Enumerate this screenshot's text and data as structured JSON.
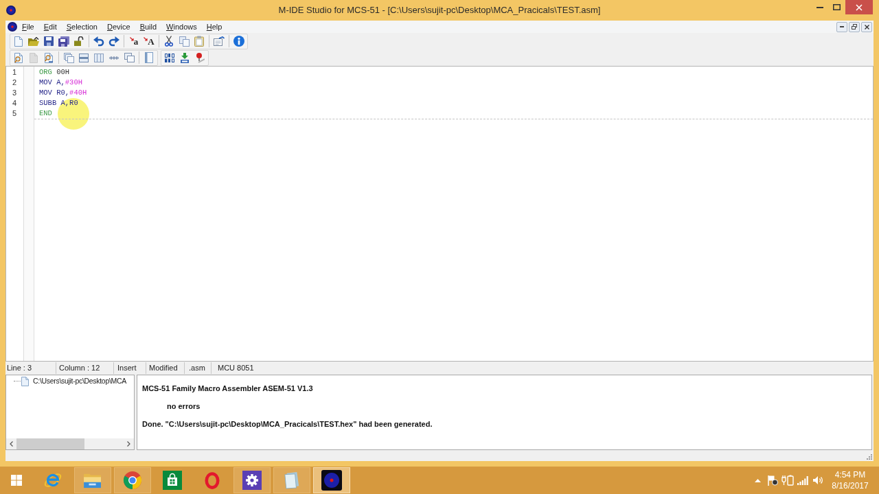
{
  "window": {
    "title": "M-IDE Studio for MCS-51 - [C:\\Users\\sujit-pc\\Desktop\\MCA_Pracicals\\TEST.asm]"
  },
  "menu": [
    "File",
    "Edit",
    "Selection",
    "Device",
    "Build",
    "Windows",
    "Help"
  ],
  "toolbars": [
    {
      "buttons": [
        {
          "disabled": false
        },
        {
          "disabled": false
        },
        {
          "disabled": false
        },
        {
          "disabled": false
        },
        {
          "disabled": false
        },
        {
          "disabled": false
        },
        {
          "disabled": false
        },
        {
          "glyph": "a",
          "disabled": false
        },
        {
          "glyph": "A",
          "disabled": false
        },
        {
          "disabled": false
        },
        {
          "disabled": false
        },
        {
          "disabled": false
        },
        {
          "disabled": false
        },
        {
          "disabled": false
        }
      ]
    },
    {
      "buttons": [
        {
          "disabled": false
        },
        {
          "disabled": true
        },
        {
          "disabled": false
        },
        {
          "disabled": false
        },
        {
          "disabled": false
        },
        {
          "disabled": false
        },
        {
          "disabled": false
        },
        {
          "disabled": false
        },
        {
          "disabled": false
        }
      ]
    },
    {
      "buttons": [
        {
          "disabled": false
        },
        {
          "disabled": false
        },
        {
          "disabled": false
        }
      ]
    }
  ],
  "editor": {
    "lines": [
      {
        "number": "1",
        "tokens": [
          {
            "text": "ORG",
            "kind": "directive"
          },
          {
            "text": " 00H",
            "kind": "number"
          }
        ]
      },
      {
        "number": "2",
        "tokens": [
          {
            "text": "MOV A,",
            "kind": "instruction"
          },
          {
            "text": "#30H",
            "kind": "immediate"
          }
        ]
      },
      {
        "number": "3",
        "tokens": [
          {
            "text": "MOV R0,",
            "kind": "instruction"
          },
          {
            "text": "#40H",
            "kind": "immediate"
          }
        ]
      },
      {
        "number": "4",
        "tokens": [
          {
            "text": "SUBB A,R0",
            "kind": "instruction"
          }
        ]
      },
      {
        "number": "5",
        "tokens": [
          {
            "text": "END",
            "kind": "directive"
          }
        ]
      }
    ]
  },
  "status_bar": [
    "Line : 3",
    "Column : 12",
    "Insert",
    "Modified",
    ".asm",
    "MCU 8051"
  ],
  "project_tree": {
    "items": [
      {
        "label": "C:\\Users\\sujit-pc\\Desktop\\MCA"
      }
    ]
  },
  "output": {
    "lines": [
      {
        "text": "MCS-51 Family Macro Assembler ASEM-51 V1.3",
        "kind": "message"
      },
      {
        "text": "no errors",
        "kind": "detail"
      },
      {
        "text": "Done. \"C:\\Users\\sujit-pc\\Desktop\\MCA_Pracicals\\TEST.hex\" had been generated.",
        "kind": "message"
      }
    ]
  },
  "taskbar": {
    "apps": [
      {
        "running": false,
        "active": false
      },
      {
        "running": true,
        "active": false
      },
      {
        "running": true,
        "active": false
      },
      {
        "running": false,
        "active": false
      },
      {
        "running": false,
        "active": false
      },
      {
        "running": true,
        "active": false
      },
      {
        "running": true,
        "active": false
      },
      {
        "running": true,
        "active": true
      }
    ],
    "clock": {
      "time": "4:54 PM",
      "date": "8/16/2017"
    }
  }
}
